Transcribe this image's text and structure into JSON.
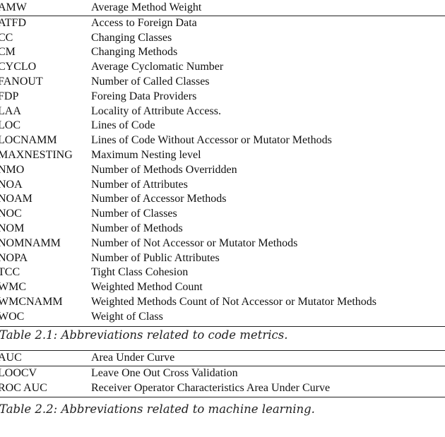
{
  "table1": {
    "header": {
      "abbr": "AMW",
      "def": "Average Method Weight"
    },
    "rows": [
      {
        "abbr": "ATFD",
        "def": "Access to Foreign Data"
      },
      {
        "abbr": "CC",
        "def": "Changing Classes"
      },
      {
        "abbr": "CM",
        "def": "Changing Methods"
      },
      {
        "abbr": "CYCLO",
        "def": "Average Cyclomatic Number"
      },
      {
        "abbr": "FANOUT",
        "def": "Number of Called Classes"
      },
      {
        "abbr": "FDP",
        "def": "Foreing Data Providers"
      },
      {
        "abbr": "LAA",
        "def": "Locality of Attribute Access."
      },
      {
        "abbr": "LOC",
        "def": "Lines of Code"
      },
      {
        "abbr": "LOCNAMM",
        "def": "Lines of Code Without Accessor or Mutator Methods"
      },
      {
        "abbr": "MAXNESTING",
        "def": "Maximum Nesting level"
      },
      {
        "abbr": "NMO",
        "def": "Number of Methods Overridden"
      },
      {
        "abbr": "NOA",
        "def": "Number of Attributes"
      },
      {
        "abbr": "NOAM",
        "def": "Number of Accessor Methods"
      },
      {
        "abbr": "NOC",
        "def": "Number of Classes"
      },
      {
        "abbr": "NOM",
        "def": "Number of Methods"
      },
      {
        "abbr": "NOMNAMM",
        "def": "Number of Not Accessor or Mutator Methods"
      },
      {
        "abbr": "NOPA",
        "def": "Number of Public Attributes"
      },
      {
        "abbr": "TCC",
        "def": "Tight Class Cohesion"
      },
      {
        "abbr": "WMC",
        "def": "Weighted Method Count"
      },
      {
        "abbr": "WMCNAMM",
        "def": "Weighted Methods Count of Not Accessor or Mutator Methods"
      },
      {
        "abbr": "WOC",
        "def": "Weight of Class"
      }
    ],
    "caption": "Table 2.1: Abbreviations related to code metrics."
  },
  "table2": {
    "header": {
      "abbr": "AUC",
      "def": "Area Under Curve"
    },
    "rows": [
      {
        "abbr": "LOOCV",
        "def": "Leave One Out Cross Validation"
      },
      {
        "abbr": "ROC AUC",
        "def": "Receiver Operator Characteristics Area Under Curve"
      }
    ],
    "caption": "Table 2.2: Abbreviations related to machine learning."
  }
}
